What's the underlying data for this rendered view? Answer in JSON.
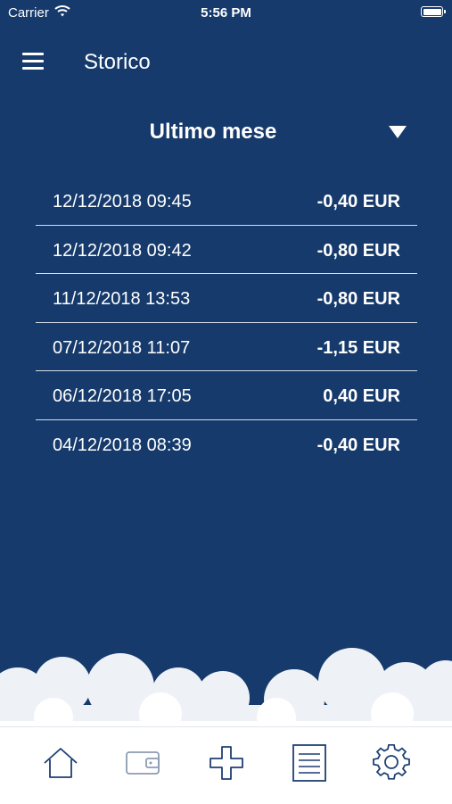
{
  "status_bar": {
    "carrier": "Carrier",
    "time": "5:56 PM"
  },
  "header": {
    "title": "Storico"
  },
  "filter": {
    "period": "Ultimo mese"
  },
  "transactions": [
    {
      "datetime": "12/12/2018 09:45",
      "amount": "-0,40 EUR"
    },
    {
      "datetime": "12/12/2018 09:42",
      "amount": "-0,80 EUR"
    },
    {
      "datetime": "11/12/2018 13:53",
      "amount": "-0,80 EUR"
    },
    {
      "datetime": "07/12/2018 11:07",
      "amount": "-1,15 EUR"
    },
    {
      "datetime": "06/12/2018 17:05",
      "amount": "0,40 EUR"
    },
    {
      "datetime": "04/12/2018 08:39",
      "amount": "-0,40 EUR"
    }
  ],
  "tab_bar": {
    "items": [
      {
        "icon": "home-icon"
      },
      {
        "icon": "wallet-icon"
      },
      {
        "icon": "plus-icon"
      },
      {
        "icon": "list-icon"
      },
      {
        "icon": "settings-gear-icon"
      }
    ]
  },
  "colors": {
    "background": "#163a6b",
    "tab_bar": "#ffffff",
    "icon_stroke": "#1f3f73",
    "divider": "#d6dde8"
  }
}
